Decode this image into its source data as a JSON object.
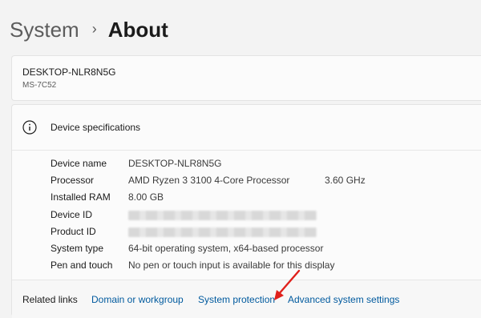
{
  "breadcrumb": {
    "parent": "System",
    "separator": "›",
    "current": "About"
  },
  "device": {
    "name": "DESKTOP-NLR8N5G",
    "model": "MS-7C52"
  },
  "specs": {
    "title": "Device specifications",
    "rows": [
      {
        "label": "Device name",
        "value": "DESKTOP-NLR8N5G",
        "extra": ""
      },
      {
        "label": "Processor",
        "value": "AMD Ryzen 3 3100 4-Core Processor",
        "extra": "3.60 GHz"
      },
      {
        "label": "Installed RAM",
        "value": "8.00 GB",
        "extra": ""
      },
      {
        "label": "Device ID",
        "value": "",
        "extra": ""
      },
      {
        "label": "Product ID",
        "value": "",
        "extra": ""
      },
      {
        "label": "System type",
        "value": "64-bit operating system, x64-based processor",
        "extra": ""
      },
      {
        "label": "Pen and touch",
        "value": "No pen or touch input is available for this display",
        "extra": ""
      }
    ]
  },
  "related": {
    "label": "Related links",
    "links": [
      "Domain or workgroup",
      "System protection",
      "Advanced system settings"
    ]
  },
  "colors": {
    "link": "#005a9e",
    "arrow": "#e0201b",
    "background": "#f3f3f3"
  },
  "icons": {
    "specs_header": "info-icon",
    "annotation": "red-arrow-icon"
  }
}
